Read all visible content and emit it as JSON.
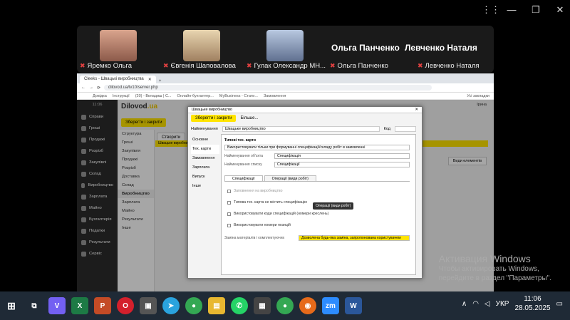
{
  "zoom": {
    "controls": [
      "⋮⋮",
      "—",
      "❐",
      "✕"
    ]
  },
  "participants": [
    {
      "name": "Яремко Ольга"
    },
    {
      "name": "Євгенія Шаповалова"
    },
    {
      "name": "Гулак Олександр МН..."
    },
    {
      "name": "Ольга Панченко",
      "big": "Ольга Панченко"
    },
    {
      "name": "Левченко Наталя",
      "big": "Левченко Наталя"
    }
  ],
  "browser": {
    "tab_title": "Cleeks - Швацькі виробництва",
    "url": "dilovod.ua/lv10/server.php",
    "bookmarks": [
      "Довідка",
      "Інструкції",
      "(20) - Вкладиш | С...",
      "Онлайн-бухгалтер...",
      "MyBusiness - Стати...",
      "Замовлення",
      "Усі закладки"
    ]
  },
  "app": {
    "logo": "Dilovod",
    "logo_dot": ".ua",
    "time": "11:06",
    "user": "Ірина",
    "save_button": "Зберегти і закрити",
    "create_button": "Створити",
    "view_button": "Види елементів",
    "yellow_row": "Швацьке виробництво",
    "sidebar": [
      "Справи",
      "Гроші",
      "Продажі",
      "Розрізб",
      "Закупівлі",
      "Склад",
      "Виробництво",
      "Зарплата",
      "Майно",
      "Бухгалтерія",
      "Податки",
      "Результати",
      "Сервіс"
    ],
    "submenu": [
      "Структура",
      "Гроші",
      "Закупівля",
      "Продажі",
      "Розрізб",
      "Доставка",
      "Склад",
      "Виробництво",
      "Зарплата",
      "Майно",
      "Результати",
      "Інше"
    ]
  },
  "modal": {
    "title": "Швацьке виробництво",
    "save": "Зберегти і закрити",
    "more": "Більше...",
    "name_label": "Найменування",
    "name_value": "Швацьке виробництво",
    "code_label": "Код",
    "left_tabs": [
      "Основне",
      "Тех. карти",
      "Замовлення",
      "Зарплата",
      "Випуск",
      "Інше"
    ],
    "section": "Типові тех. карти",
    "field1": "Використовувати тільки при формуванні специфікації/складу робіт в замовленні",
    "obj_label": "Найменування об'єкта",
    "obj_value": "Специфікація",
    "list_label": "Найменування списку",
    "list_value": "Специфікації",
    "subtab1": "Специфікації",
    "subtab2": "Операції (види робіт)",
    "tooltip": "Операції (види робіт)",
    "chk1": "Заповнення на виробництво",
    "chk2": "Типова тех. карта не містить специфікацію",
    "chk3": "Використовувати коди специфікацій (номери креслень)",
    "chk4": "Використовувати номери позицій",
    "mat_label": "Заміна матеріалів і комплектуючих",
    "mat_value": "Дозволена будь-яка заміна, запропонована користувачем"
  },
  "watermark": {
    "line1": "Активация Windows",
    "line2": "Чтобы активировать Windows,",
    "line3": "перейдите в раздел \"Параметры\"."
  },
  "taskbar": {
    "lang": "УКР",
    "time": "11:06",
    "date": "28.05.2025"
  },
  "colors": {
    "accent": "#ffe400",
    "sidebar": "#2b2b2b",
    "taskbar": "#1f2a36"
  }
}
